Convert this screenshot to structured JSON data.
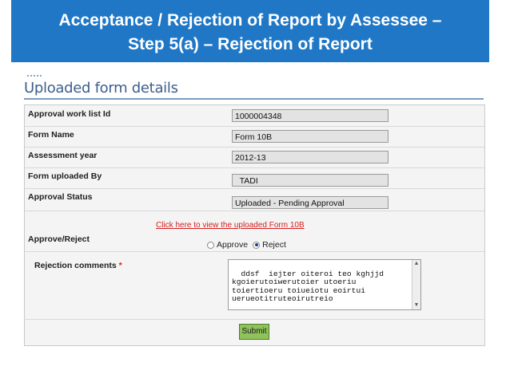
{
  "slide": {
    "title_line1": "Acceptance / Rejection of Report by Assessee –",
    "title_line2": "Step 5(a) – Rejection of Report"
  },
  "form": {
    "heading": "Uploaded form details",
    "fields": [
      {
        "label": "Approval work list Id",
        "value": "1000004348"
      },
      {
        "label": "Form Name",
        "value": "Form  10B"
      },
      {
        "label": "Assessment year",
        "value": "2012-13"
      },
      {
        "label": "Form uploaded By",
        "value": "  TADI"
      },
      {
        "label": "Approval Status",
        "value": "Uploaded - Pending Approval"
      }
    ],
    "view_link": "Click here to view the uploaded Form 10B",
    "approve_reject": {
      "label": "Approve/Reject",
      "options": [
        "Approve",
        "Reject"
      ],
      "selected": "Reject"
    },
    "comments": {
      "label": "Rejection comments",
      "required_mark": "*",
      "value": "ddsf  iejter oiteroi teo kghjjd\nkgoierutoiwerutoier utoeriu\ntoiertioeru toiueiotu eoirtui\nuerueotitruteoirutreio"
    },
    "submit_label": "Submit"
  },
  "colors": {
    "banner": "#1f77c6",
    "link": "#d42020",
    "submit": "#8fc25a"
  }
}
